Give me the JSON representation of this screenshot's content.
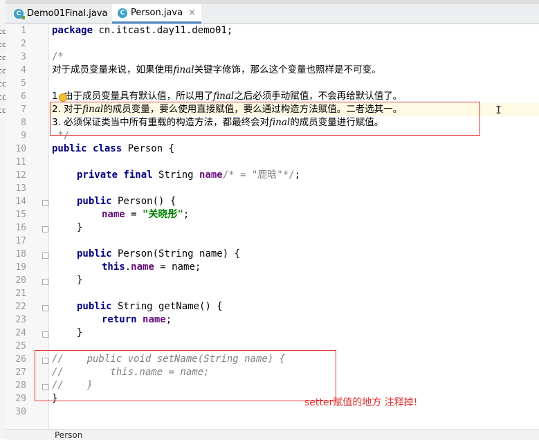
{
  "tabs": [
    {
      "label": "Demo01Final.java",
      "close": "×",
      "icon": "java-class-icon",
      "active": false
    },
    {
      "label": "Person.java",
      "close": "×",
      "icon": "java-class-icon",
      "active": true
    }
  ],
  "left_strip_letters": [
    "cc",
    "cc",
    "cc",
    "cc",
    "cc",
    "cc",
    "cc"
  ],
  "code": {
    "l1": {
      "kw": "package",
      "text": " cn.itcast.day11.demo01;"
    },
    "l3": "/*",
    "l4": {
      "a": "对于成员变量来说，如果使用",
      "b": "final",
      "c": "关键字修饰，那么这个变量也照样是不可变。"
    },
    "l6": {
      "a": "1. 由于成员变量具有默认值，所以用了",
      "b": "final",
      "c": "之后必须手动赋值，不会再给默认值了。"
    },
    "l7": {
      "a": "2. 对于",
      "b": "final",
      "c": "的成员变量，要么使用直接赋值，要么通过构造方法赋值。二者选其一。"
    },
    "l8": {
      "a": "3. 必须保证类当中所有重载的构造方法，都最终会对",
      "b": "final",
      "c": "的成员变量进行赋值。"
    },
    "l9": " */",
    "l10": {
      "kw": "public class",
      "text": " Person {"
    },
    "l12": {
      "kw": "private final",
      "t1": " String ",
      "fld": "name",
      "cm": "/* = \"鹿晗\"*/",
      "end": ";"
    },
    "l14": {
      "kw": "public",
      "t1": " Person() {"
    },
    "l15": {
      "fld": "name",
      "t1": " = ",
      "str": "\"关晓彤\"",
      "end": ";"
    },
    "l16": "}",
    "l18": {
      "kw": "public",
      "t1": " Person(String name) {"
    },
    "l19": {
      "kw": "this",
      "t1": ".",
      "fld": "name",
      "t2": " = name;"
    },
    "l20": "}",
    "l22": {
      "kw": "public",
      "t1": " String getName() {"
    },
    "l23": {
      "kw": "return",
      "t1": " ",
      "fld": "name",
      "end": ";"
    },
    "l24": "}",
    "l26": "//    public void setName(String name) {",
    "l27": "//        this.name = name;",
    "l28": "//    }",
    "l29": "}"
  },
  "line_numbers": [
    "1",
    "2",
    "3",
    "4",
    "5",
    "6",
    "7",
    "8",
    "9",
    "10",
    "11",
    "12",
    "13",
    "14",
    "15",
    "16",
    "17",
    "18",
    "19",
    "20",
    "21",
    "22",
    "23",
    "24",
    "25",
    "26",
    "27",
    "28",
    "29",
    "30"
  ],
  "annotation": "setter赋值的地方 注释掉!",
  "status": {
    "text": "Person"
  },
  "colors": {
    "highlight_box": "#e03030",
    "keyword": "#000080",
    "field": "#660e7a",
    "string": "#008000",
    "comment": "#808080"
  }
}
